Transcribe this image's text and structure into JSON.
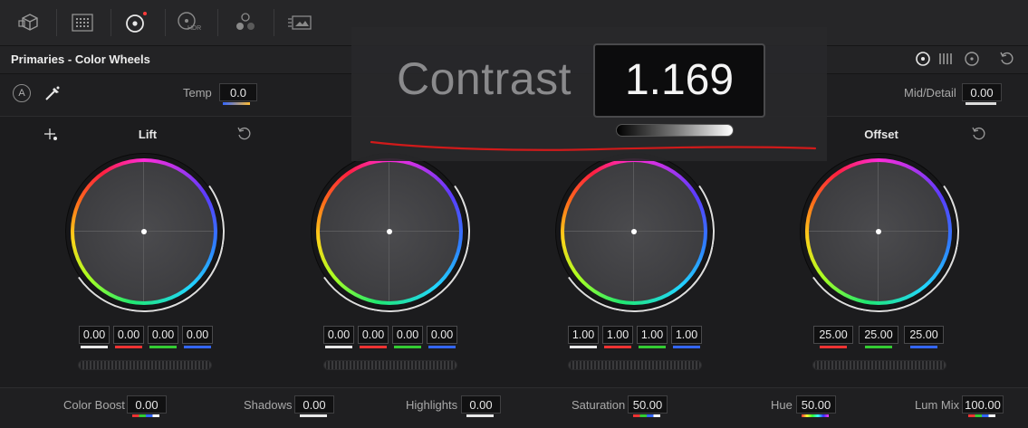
{
  "colors": {
    "accent_red": "#ff3b3b",
    "annotation_red": "#d11a1a",
    "panel_bg": "#1c1c1e"
  },
  "toolbar": {
    "icons": [
      "3d-cube-icon",
      "grid-icon",
      "color-wheel-icon",
      "hdr-wheel-icon",
      "rgb-mixer-icon",
      "motion-effects-icon"
    ],
    "hdr_label": "HDR"
  },
  "header": {
    "title": "Primaries - Color Wheels"
  },
  "subbar": {
    "temp_label": "Temp",
    "temp_value": "0.0",
    "mid_detail_label": "Mid/Detail",
    "mid_detail_value": "0.00",
    "auto_label": "A"
  },
  "wheels": [
    {
      "title": "Lift",
      "values": [
        "0.00",
        "0.00",
        "0.00",
        "0.00"
      ]
    },
    {
      "title": "",
      "values": [
        "0.00",
        "0.00",
        "0.00",
        "0.00"
      ]
    },
    {
      "title": "",
      "values": [
        "1.00",
        "1.00",
        "1.00",
        "1.00"
      ]
    },
    {
      "title": "Offset",
      "values": [
        "25.00",
        "25.00",
        "25.00"
      ]
    }
  ],
  "bottom": {
    "color_boost_label": "Color Boost",
    "color_boost_value": "0.00",
    "shadows_label": "Shadows",
    "shadows_value": "0.00",
    "highlights_label": "Highlights",
    "highlights_value": "0.00",
    "saturation_label": "Saturation",
    "saturation_value": "50.00",
    "hue_label": "Hue",
    "hue_value": "50.00",
    "lum_mix_label": "Lum Mix",
    "lum_mix_value": "100.00"
  },
  "overlay": {
    "label": "Contrast",
    "value": "1.169"
  }
}
